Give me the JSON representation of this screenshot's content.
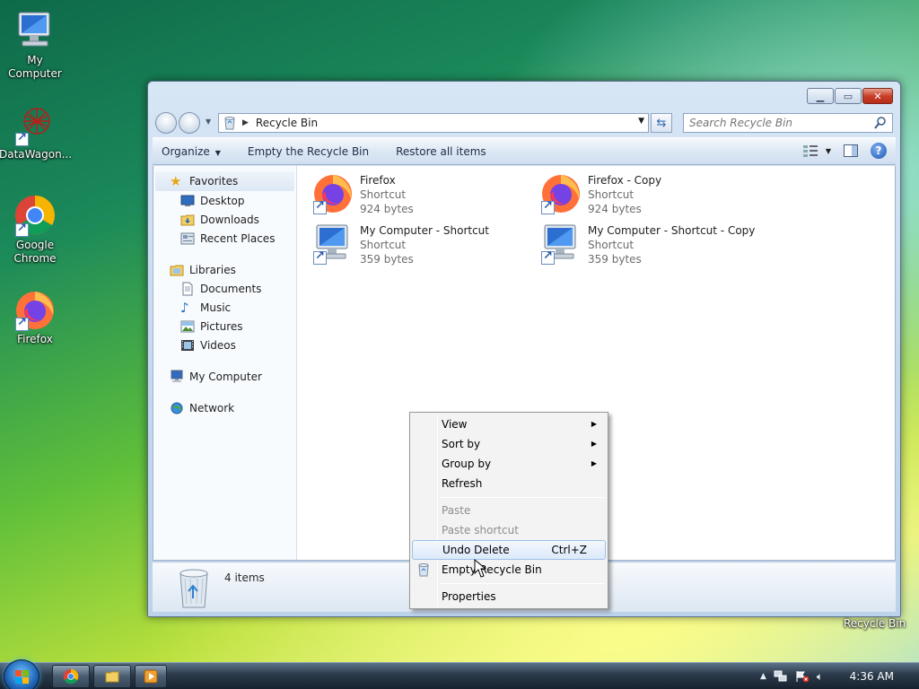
{
  "desktop": {
    "icons": [
      {
        "label": "My Computer",
        "icon": "computer-icon"
      },
      {
        "label": "DataWagon...",
        "icon": "datawagon-icon"
      },
      {
        "label": "Google Chrome",
        "icon": "chrome-icon"
      },
      {
        "label": "Firefox",
        "icon": "firefox-icon"
      }
    ],
    "recycle_bin_label": "Recycle Bin"
  },
  "window": {
    "address": "Recycle Bin",
    "search_placeholder": "Search Recycle Bin",
    "commands": {
      "organize": "Organize",
      "empty": "Empty the Recycle Bin",
      "restore": "Restore all items"
    },
    "sidebar": {
      "favorites_header": "Favorites",
      "favorites": [
        "Desktop",
        "Downloads",
        "Recent Places"
      ],
      "libraries_header": "Libraries",
      "libraries": [
        "Documents",
        "Music",
        "Pictures",
        "Videos"
      ],
      "my_computer": "My Computer",
      "network": "Network"
    },
    "files": [
      {
        "name": "Firefox",
        "type": "Shortcut",
        "size": "924 bytes",
        "icon": "firefox-icon"
      },
      {
        "name": "Firefox - Copy",
        "type": "Shortcut",
        "size": "924 bytes",
        "icon": "firefox-icon"
      },
      {
        "name": "My Computer - Shortcut",
        "type": "Shortcut",
        "size": "359 bytes",
        "icon": "computer-icon"
      },
      {
        "name": "My Computer - Shortcut - Copy",
        "type": "Shortcut",
        "size": "359 bytes",
        "icon": "computer-icon"
      }
    ],
    "item_count": "4 items"
  },
  "context_menu": {
    "view": "View",
    "sort_by": "Sort by",
    "group_by": "Group by",
    "refresh": "Refresh",
    "paste": "Paste",
    "paste_shortcut": "Paste shortcut",
    "undo_delete": "Undo Delete",
    "undo_shortcut": "Ctrl+Z",
    "empty_recycle_bin": "Empty Recycle Bin",
    "properties": "Properties"
  },
  "taskbar": {
    "clock": "4:36 AM"
  }
}
